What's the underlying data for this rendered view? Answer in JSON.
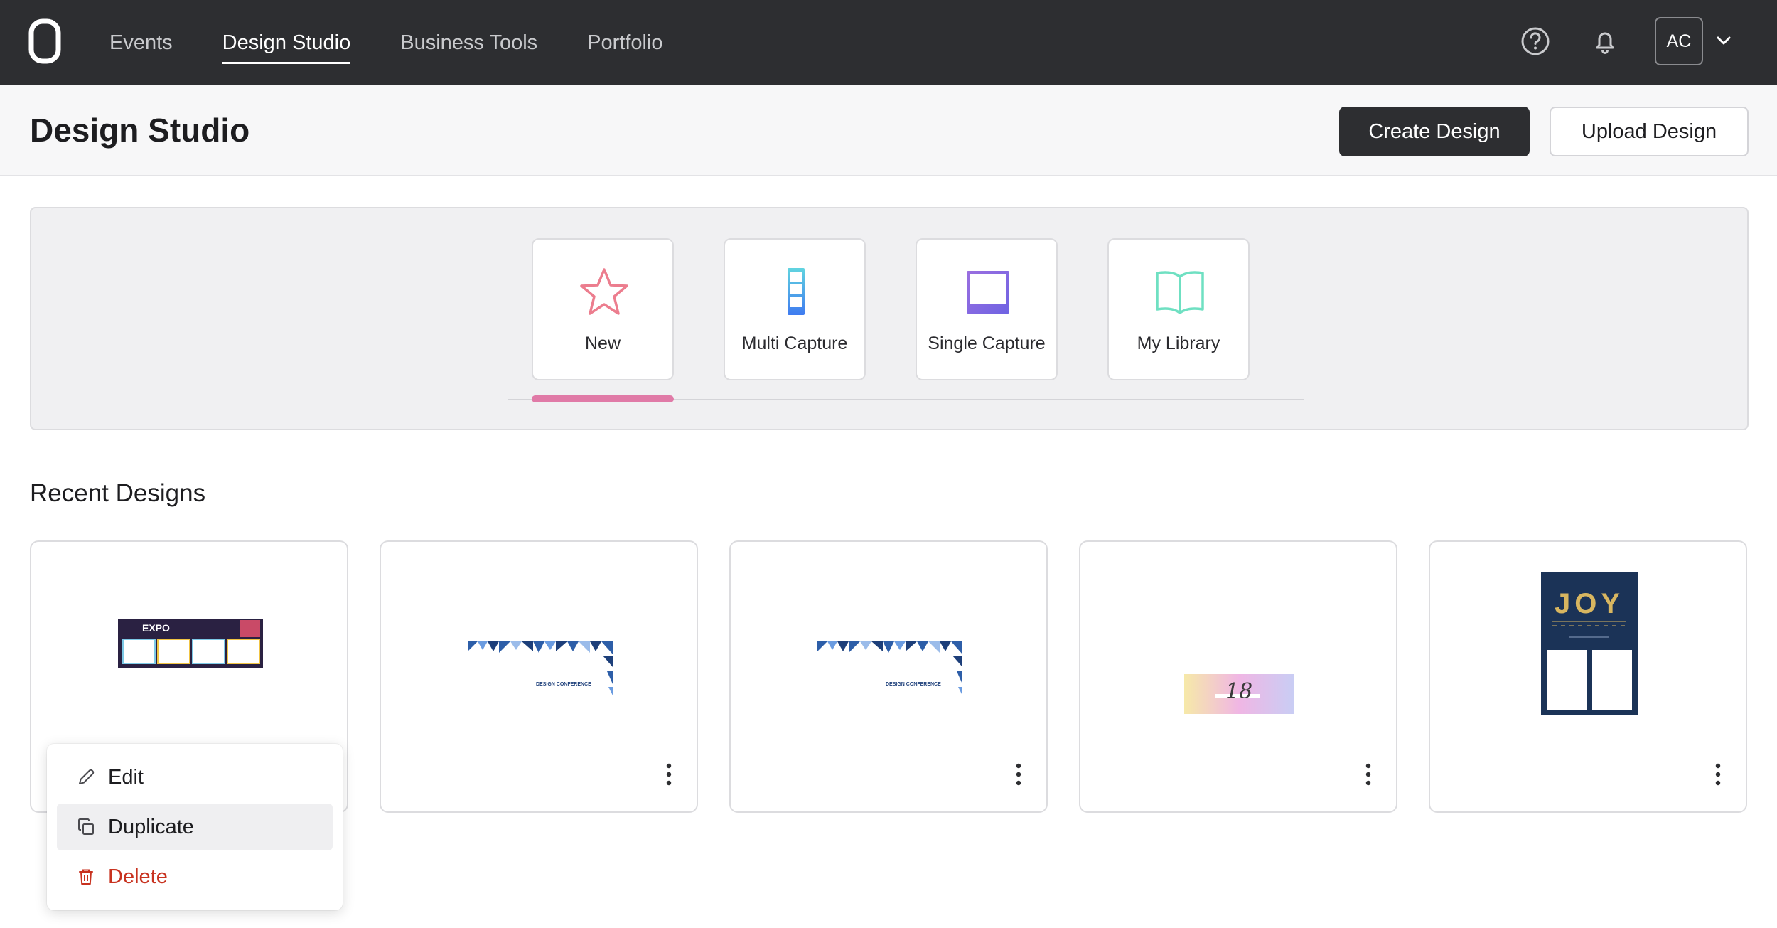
{
  "nav": {
    "logo_icon": "brand-logo-icon",
    "items": [
      {
        "label": "Events",
        "active": false
      },
      {
        "label": "Design Studio",
        "active": true
      },
      {
        "label": "Business Tools",
        "active": false
      },
      {
        "label": "Portfolio",
        "active": false
      }
    ],
    "help_icon": "help-circle-icon",
    "bell_icon": "bell-icon",
    "avatar_initials": "AC",
    "avatar_chevron_icon": "chevron-down-icon"
  },
  "header": {
    "title": "Design Studio",
    "create_label": "Create Design",
    "upload_label": "Upload Design"
  },
  "types": [
    {
      "label": "New",
      "icon": "star-icon",
      "selected": true
    },
    {
      "label": "Multi Capture",
      "icon": "multi-capture-icon",
      "selected": false
    },
    {
      "label": "Single Capture",
      "icon": "single-capture-icon",
      "selected": false
    },
    {
      "label": "My Library",
      "icon": "book-icon",
      "selected": false
    }
  ],
  "recent": {
    "title": "Recent Designs",
    "designs": [
      {
        "thumb": "expo-strip-thumbnail",
        "thumb_text": "EXPO",
        "menu_icon": "more-vertical-icon"
      },
      {
        "thumb": "design-conference-thumbnail",
        "thumb_text": "DESIGN CONFERENCE",
        "menu_icon": "more-vertical-icon"
      },
      {
        "thumb": "design-conference-thumbnail",
        "thumb_text": "DESIGN CONFERENCE",
        "menu_icon": "more-vertical-icon"
      },
      {
        "thumb": "gradient-18-thumbnail",
        "thumb_text": "18",
        "menu_icon": "more-vertical-icon"
      },
      {
        "thumb": "joy-card-thumbnail",
        "thumb_text": "JOY",
        "menu_icon": "more-vertical-icon"
      }
    ]
  },
  "context_menu": {
    "items": [
      {
        "label": "Edit",
        "icon": "pencil-icon"
      },
      {
        "label": "Duplicate",
        "icon": "copy-icon"
      },
      {
        "label": "Delete",
        "icon": "trash-icon"
      }
    ]
  },
  "colors": {
    "topbar": "#2d2e31",
    "accent_pink": "#e07aa7",
    "danger": "#c8321f"
  }
}
